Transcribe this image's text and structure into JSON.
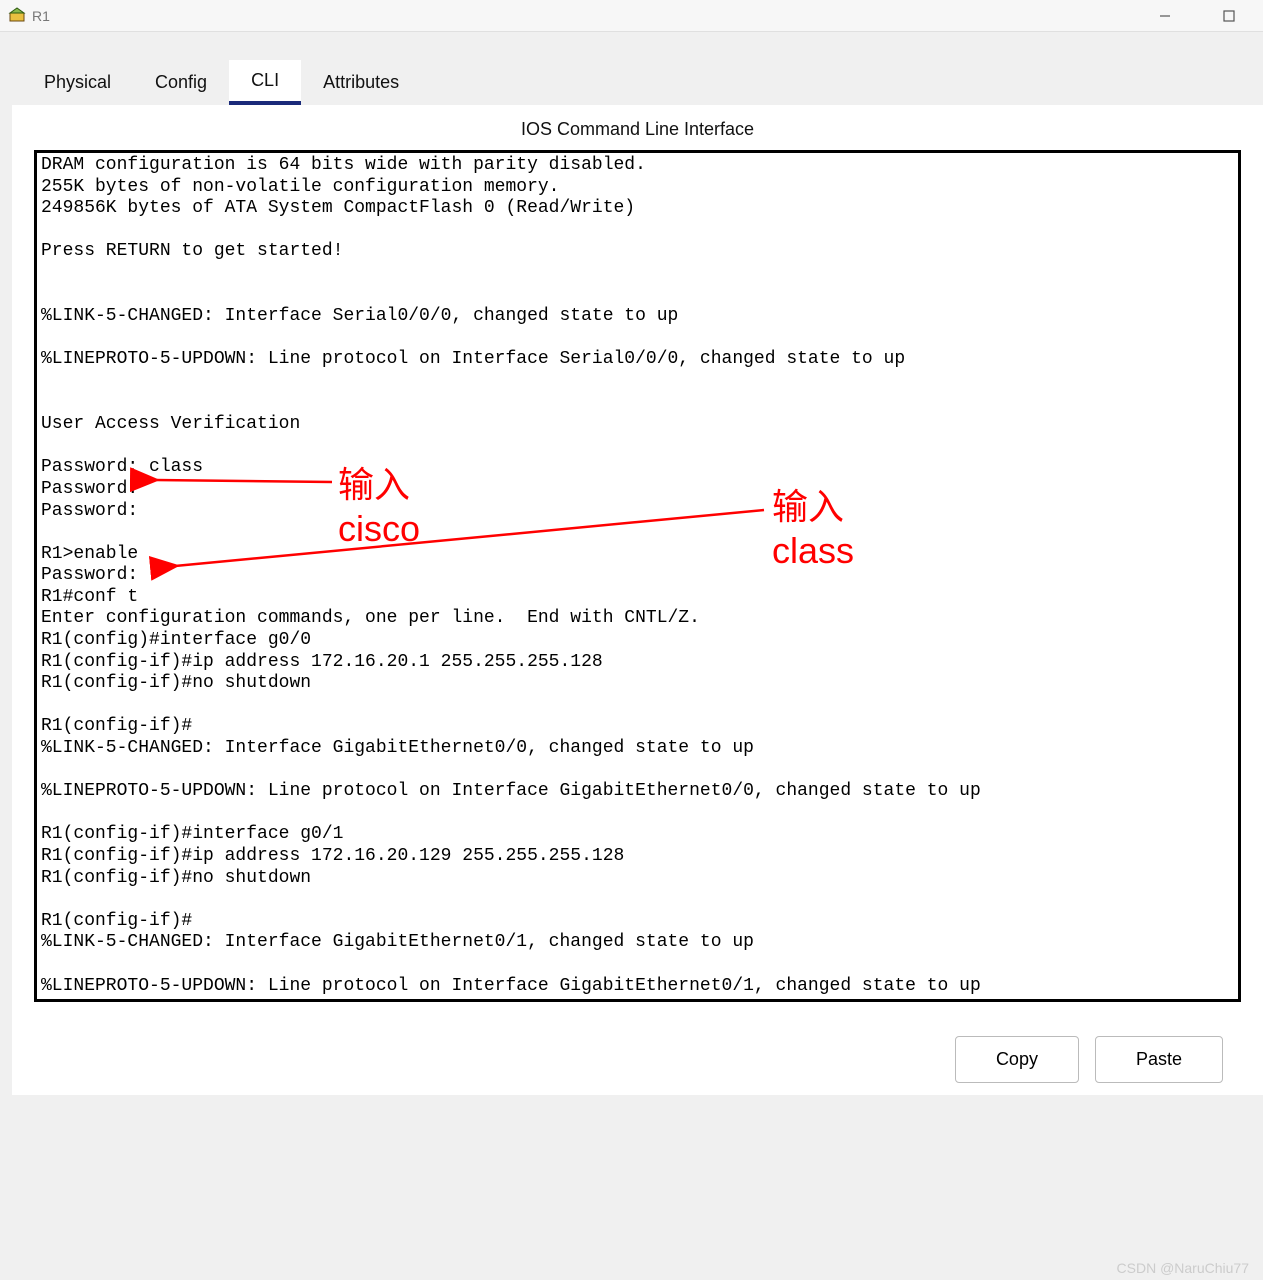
{
  "window": {
    "title": "R1"
  },
  "tabs": {
    "physical": "Physical",
    "config": "Config",
    "cli": "CLI",
    "attributes": "Attributes"
  },
  "panel": {
    "title": "IOS Command Line Interface"
  },
  "cli": {
    "lines": [
      "DRAM configuration is 64 bits wide with parity disabled.",
      "255K bytes of non-volatile configuration memory.",
      "249856K bytes of ATA System CompactFlash 0 (Read/Write)",
      "",
      "Press RETURN to get started!",
      "",
      "",
      "%LINK-5-CHANGED: Interface Serial0/0/0, changed state to up",
      "",
      "%LINEPROTO-5-UPDOWN: Line protocol on Interface Serial0/0/0, changed state to up",
      "",
      "",
      "User Access Verification",
      "",
      "Password: class",
      "Password: ",
      "Password: ",
      "",
      "R1>enable",
      "Password: ",
      "R1#conf t",
      "Enter configuration commands, one per line.  End with CNTL/Z.",
      "R1(config)#interface g0/0",
      "R1(config-if)#ip address 172.16.20.1 255.255.255.128",
      "R1(config-if)#no shutdown",
      "",
      "R1(config-if)#",
      "%LINK-5-CHANGED: Interface GigabitEthernet0/0, changed state to up",
      "",
      "%LINEPROTO-5-UPDOWN: Line protocol on Interface GigabitEthernet0/0, changed state to up",
      "",
      "R1(config-if)#interface g0/1",
      "R1(config-if)#ip address 172.16.20.129 255.255.255.128",
      "R1(config-if)#no shutdown",
      "",
      "R1(config-if)#",
      "%LINK-5-CHANGED: Interface GigabitEthernet0/1, changed state to up",
      "",
      "%LINEPROTO-5-UPDOWN: Line protocol on Interface GigabitEthernet0/1, changed state to up",
      ""
    ]
  },
  "buttons": {
    "copy": "Copy",
    "paste": "Paste"
  },
  "annotations": {
    "cisco": "输入cisco",
    "class": "输入class"
  },
  "watermark": "CSDN @NaruChiu77"
}
